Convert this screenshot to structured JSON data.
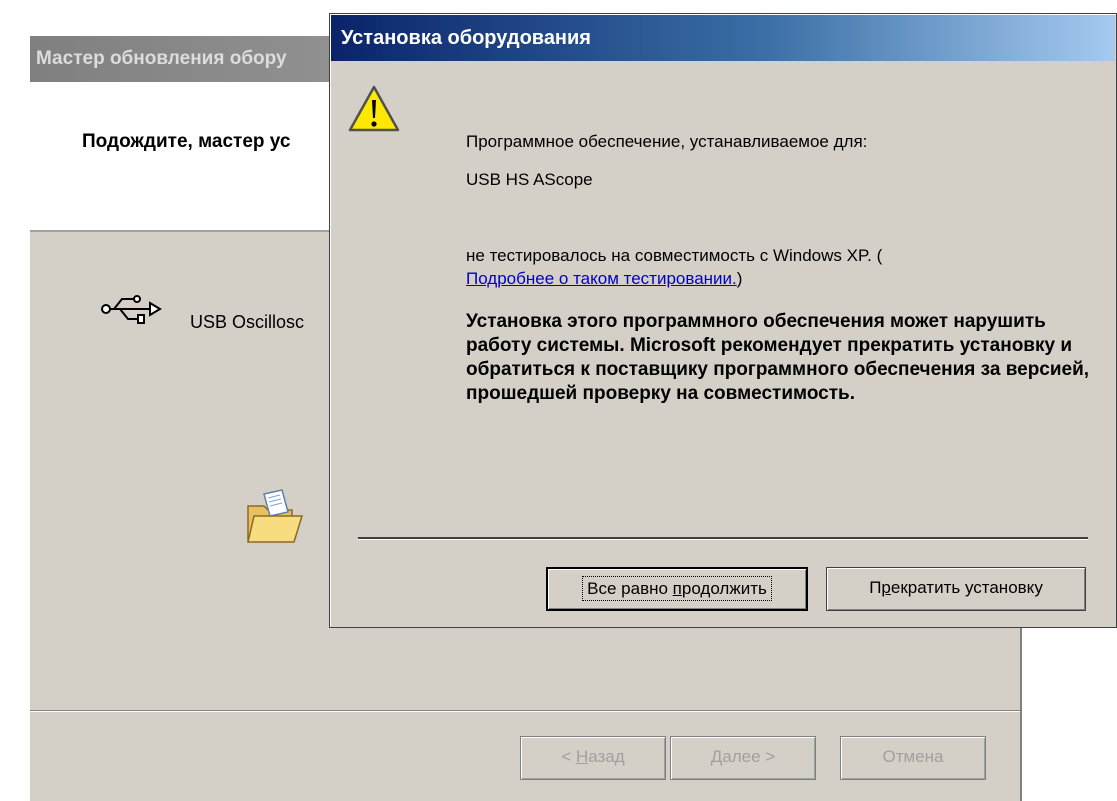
{
  "wizard": {
    "title": "Мастер обновления обору",
    "heading": "Подождите, мастер ус",
    "device_label": "USB Oscillosc",
    "buttons": {
      "back_prefix": "< ",
      "back_access": "Н",
      "back_rest": "азад",
      "next_access": "Д",
      "next_rest": "алее >",
      "cancel": "Отмена"
    }
  },
  "dialog": {
    "title": "Установка оборудования",
    "line1": "Программное обеспечение, устанавливаемое для:",
    "device": "USB HS AScope",
    "compat_text": "не тестировалось на совместимость с Windows XP. (",
    "link_text": "Подробнее о таком тестировании.",
    "compat_close": ")",
    "warning": "Установка этого программного обеспечения может нарушить работу системы. Microsoft рекомендует прекратить установку и обратиться к поставщику программного обеспечения за версией, прошедшей проверку на совместимость.",
    "buttons": {
      "continue_before": "Все равно ",
      "continue_access": "п",
      "continue_after": "родолжить",
      "stop_before": "П",
      "stop_access": "р",
      "stop_after": "екратить установку"
    }
  },
  "colors": {
    "titlebar_active": "#0a246a",
    "titlebar_inactive": "#808080",
    "face": "#d4d0c8",
    "link": "#0000c8"
  },
  "icons": [
    "usb-icon",
    "folder-icon",
    "warning-icon"
  ]
}
